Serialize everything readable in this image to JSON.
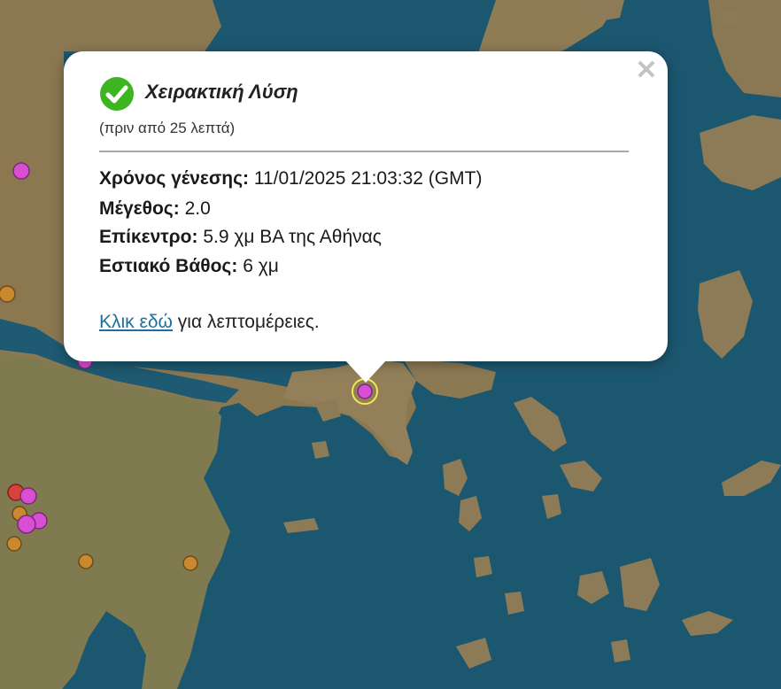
{
  "popup": {
    "title": "Χειρακτική Λύση",
    "time_ago": "(πριν από 25 λεπτά)",
    "fields": [
      {
        "label": "Χρόνος γένεσης:",
        "value": "11/01/2025 21:03:32 (GMT)"
      },
      {
        "label": "Μέγεθος:",
        "value": "2.0"
      },
      {
        "label": "Επίκεντρο:",
        "value": "5.9 χμ ΒΑ της Αθήνας"
      },
      {
        "label": "Εστιακό Βάθος:",
        "value": "6 χμ"
      }
    ],
    "link_text": "Κλικ εδώ",
    "link_suffix": " για λεπτομέρειες.",
    "close_glyph": "✕"
  },
  "colors": {
    "sea": "#1e5a72",
    "land": "#8d7a55",
    "quake_recent": "#d94fd3",
    "quake_older": "#c9892e",
    "quake_red": "#d9423a",
    "selected_ring": "#f2e94a",
    "check": "#3cb521",
    "link": "#1f6e9c"
  }
}
